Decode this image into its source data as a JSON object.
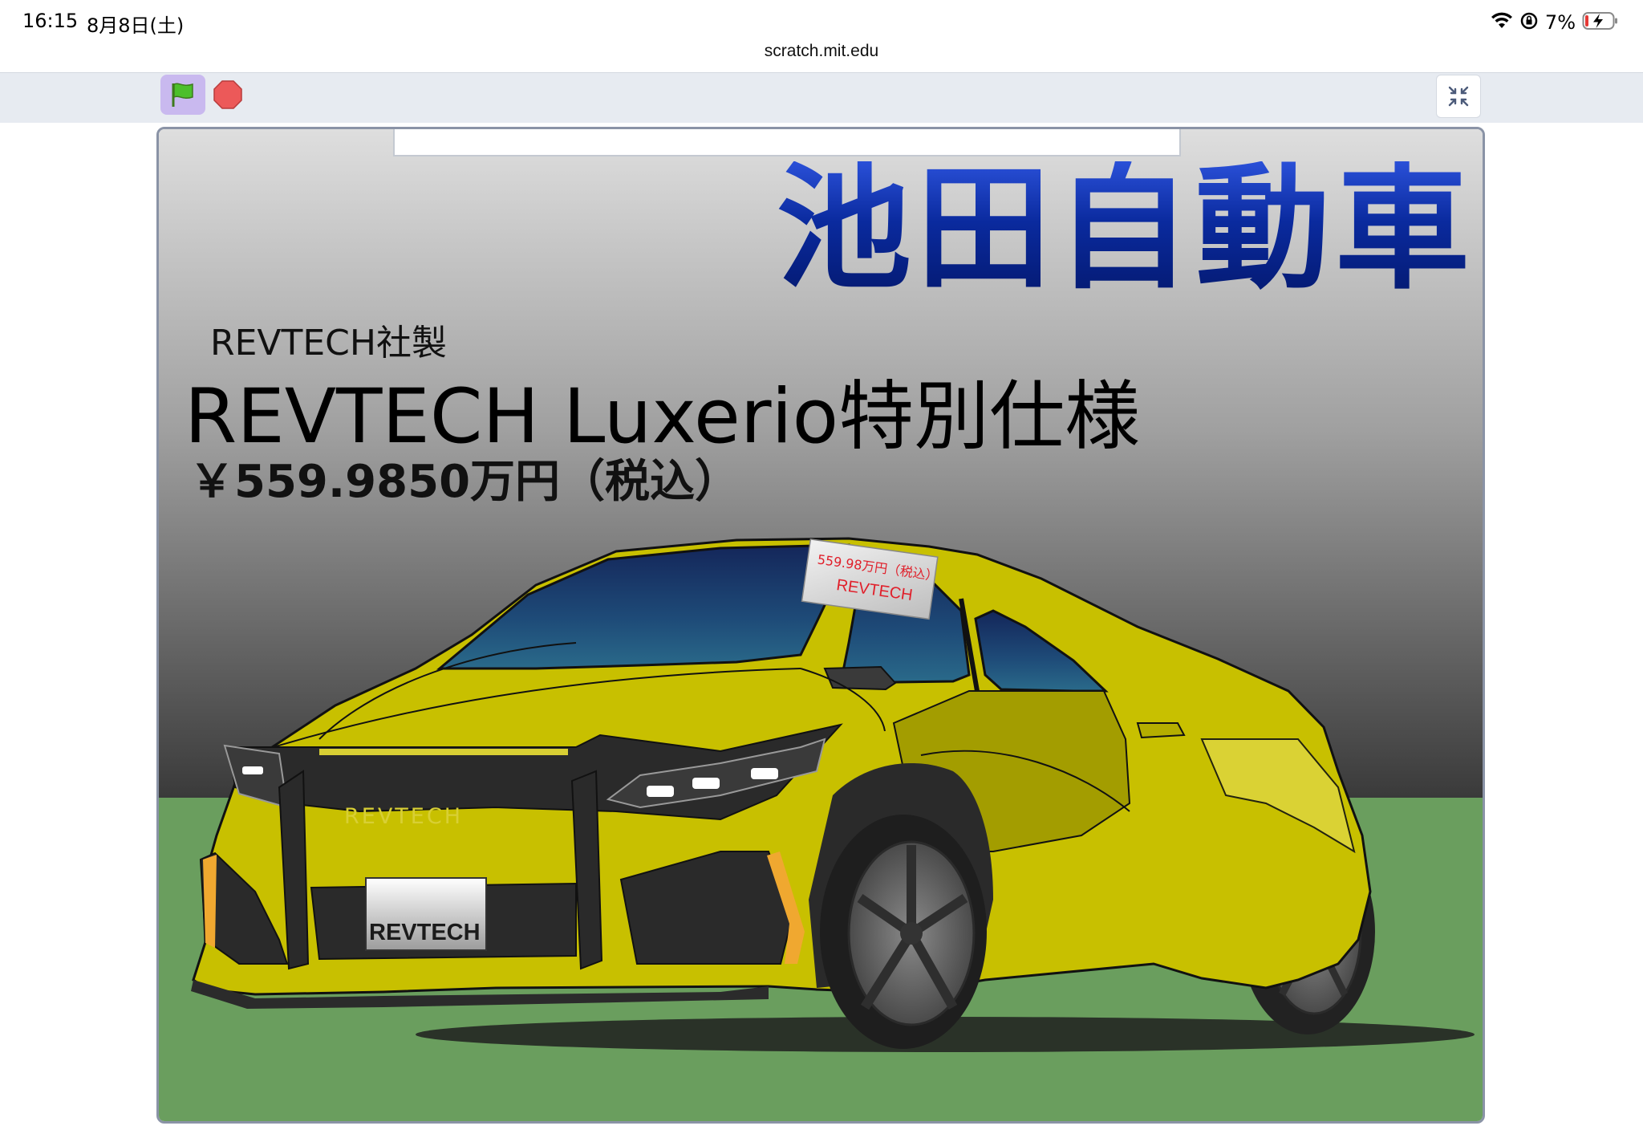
{
  "status_bar": {
    "time": "16:15",
    "date": "8月8日(土)",
    "battery_percent": "7%",
    "icons": [
      "wifi-icon",
      "orientation-lock-icon",
      "battery-charging-icon"
    ]
  },
  "browser": {
    "url": "scratch.mit.edu"
  },
  "scratch_controls": {
    "green_flag": "green-flag-icon",
    "stop": "stop-icon",
    "fullscreen": "exit-fullscreen-icon"
  },
  "stage": {
    "dealer_name": "池田自動車",
    "maker": "REVTECH社製",
    "model": "REVTECH Luxerio特別仕様",
    "price": "￥559.9850万円（税込）",
    "sticker_price": "559.98万円（税込）",
    "sticker_brand": "REVTECH",
    "grille_brand": "REVTECH",
    "plate_text": "REVTECH"
  },
  "colors": {
    "car_body": "#c8c000",
    "ground": "#6a9e5e",
    "sky_top": "#dadada",
    "sky_bottom": "#3c3c3c",
    "dealer_text": "#0b2a9a",
    "sticker_text": "#e01f2a",
    "flag_button_bg": "#c9b9ef",
    "stop_red": "#ec5959"
  }
}
